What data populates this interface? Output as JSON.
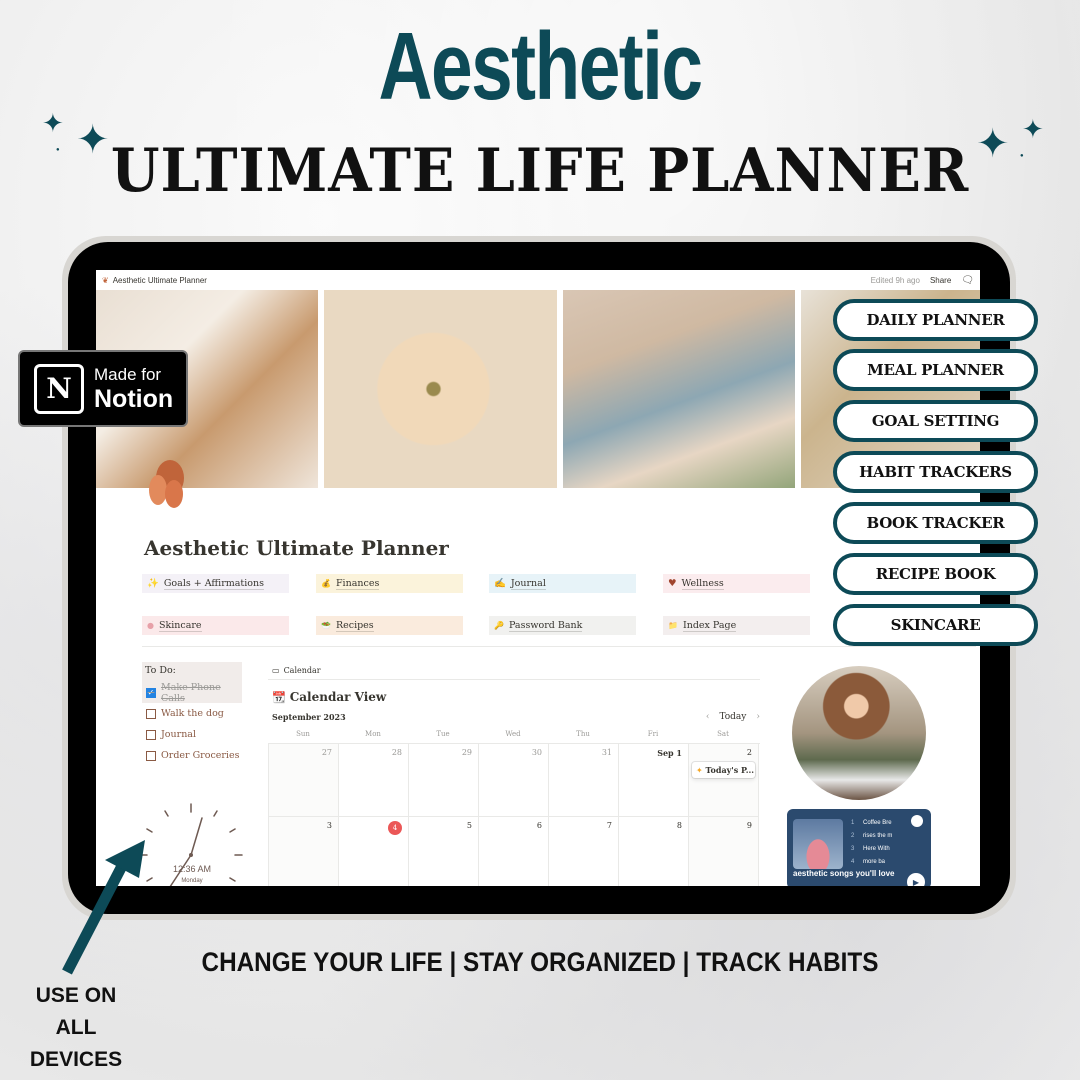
{
  "hero": {
    "title": "Aesthetic",
    "subtitle": "ULTIMATE LIFE PLANNER",
    "accent_color": "#0d4a57"
  },
  "badge": {
    "line1": "Made for",
    "line2": "Notion",
    "logo_letter": "N"
  },
  "notion_page": {
    "topbar": {
      "breadcrumb": "Aesthetic Ultimate Planner",
      "edited": "Edited 9h ago",
      "share": "Share"
    },
    "title": "Aesthetic Ultimate Planner",
    "nav_links": [
      {
        "icon": "✨",
        "label": "Goals + Affirmations",
        "bg": "#f4f1f7"
      },
      {
        "icon": "💰",
        "label": "Finances",
        "bg": "#fbf3db"
      },
      {
        "icon": "✍",
        "label": "Journal",
        "bg": "#e7f3f8"
      },
      {
        "icon": "♥",
        "label": "Wellness",
        "bg": "#fbecee"
      },
      {
        "icon": "●",
        "label": "Skincare",
        "bg": "#fbe9ea"
      },
      {
        "icon": "🥗",
        "label": "Recipes",
        "bg": "#faebdd"
      },
      {
        "icon": "🔑",
        "label": "Password Bank",
        "bg": "#f1f1ef"
      },
      {
        "icon": "📁",
        "label": "Index Page",
        "bg": "#f3eeee"
      }
    ],
    "todo": {
      "heading": "To Do:",
      "items": [
        {
          "label": "Make Phone Calls",
          "checked": true
        },
        {
          "label": "Walk the dog",
          "checked": false
        },
        {
          "label": "Journal",
          "checked": false
        },
        {
          "label": "Order Groceries",
          "checked": false
        }
      ]
    },
    "calendar": {
      "tab": "Calendar",
      "view_title": "Calendar View",
      "month": "September 2023",
      "today_button": "Today",
      "weekdays": [
        "Sun",
        "Mon",
        "Tue",
        "Wed",
        "Thu",
        "Fri",
        "Sat"
      ],
      "weeks": [
        [
          "27",
          "28",
          "29",
          "30",
          "31",
          "Sep 1",
          "2"
        ],
        [
          "3",
          "4",
          "5",
          "6",
          "7",
          "8",
          "9"
        ]
      ],
      "today": "4",
      "event": {
        "icon": "✦",
        "label": "Today's P..."
      }
    },
    "clock": {
      "time": "12:36 AM",
      "day": "Monday"
    },
    "spotify": {
      "playlist": "aesthetic songs you'll love",
      "tracks": [
        "Coffee Bre",
        "rises the m",
        "Here With",
        "more ba"
      ]
    }
  },
  "features": [
    "DAILY PLANNER",
    "MEAL PLANNER",
    "GOAL SETTING",
    "HABIT TRACKERS",
    "BOOK TRACKER",
    "RECIPE BOOK",
    "SKINCARE"
  ],
  "tagline": "CHANGE YOUR LIFE | STAY ORGANIZED | TRACK HABITS",
  "devices": [
    "USE ON",
    "ALL",
    "DEVICES"
  ]
}
